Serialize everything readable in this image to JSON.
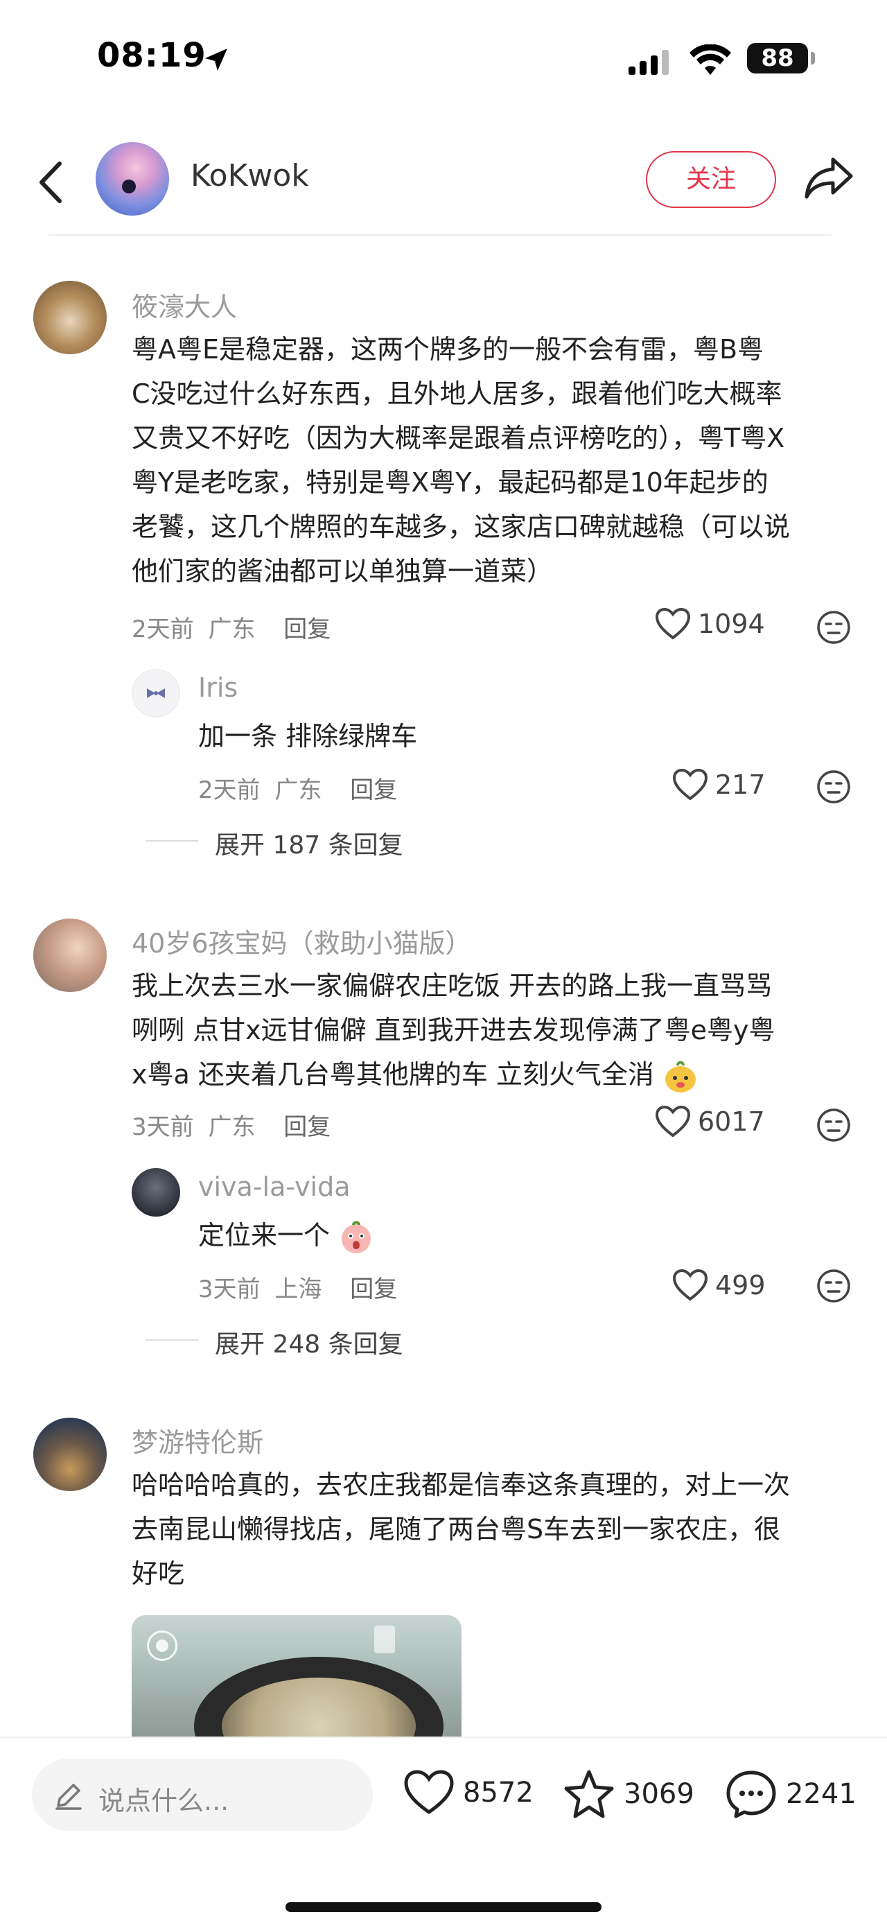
{
  "status_bar": {
    "time": "08:19",
    "battery": "88"
  },
  "header": {
    "user_name": "KoKwok",
    "follow_label": "关注"
  },
  "comments": [
    {
      "author": "筱濠大人",
      "lines": [
        "粤A粤E是稳定器，这两个牌多的一般不会有雷，粤B粤",
        "C没吃过什么好东西，且外地人居多，跟着他们吃大概率",
        "又贵又不好吃（因为大概率是跟着点评榜吃的），粤T粤X",
        "粤Y是老吃家，特别是粤X粤Y，最起码都是10年起步的",
        "老饕，这几个牌照的车越多，这家店口碑就越稳（可以说",
        "他们家的酱油都可以单独算一道菜）"
      ],
      "time": "2天前",
      "location": "广东",
      "reply_label": "回复",
      "likes": "1094",
      "replies": [
        {
          "author": "Iris",
          "text": "加一条 排除绿牌车",
          "time": "2天前",
          "location": "广东",
          "reply_label": "回复",
          "likes": "217"
        }
      ],
      "expand_label": "展开 187 条回复"
    },
    {
      "author": "40岁6孩宝妈（救助小猫版）",
      "lines": [
        "我上次去三水一家偏僻农庄吃饭 开去的路上我一直骂骂",
        "咧咧 点甘x远甘偏僻 直到我开进去发现停满了粤e粤y粤",
        "x粤a 还夹着几台粤其他牌的车 立刻火气全消"
      ],
      "time": "3天前",
      "location": "广东",
      "reply_label": "回复",
      "likes": "6017",
      "replies": [
        {
          "author": "viva-la-vida",
          "text": "定位来一个",
          "time": "3天前",
          "location": "上海",
          "reply_label": "回复",
          "likes": "499"
        }
      ],
      "expand_label": "展开 248 条回复"
    },
    {
      "author": "梦游特伦斯",
      "lines": [
        "哈哈哈哈真的，去农庄我都是信奉这条真理的，对上一次",
        "去南昆山懒得找店，尾随了两台粤S车去到一家农庄，很",
        "好吃"
      ]
    }
  ],
  "bottom_bar": {
    "input_placeholder": "说点什么...",
    "likes": "8572",
    "favorites": "3069",
    "comments": "2241"
  },
  "colors": {
    "accent": "#e3344a",
    "meta": "#888888",
    "author": "#9a9a9a"
  }
}
